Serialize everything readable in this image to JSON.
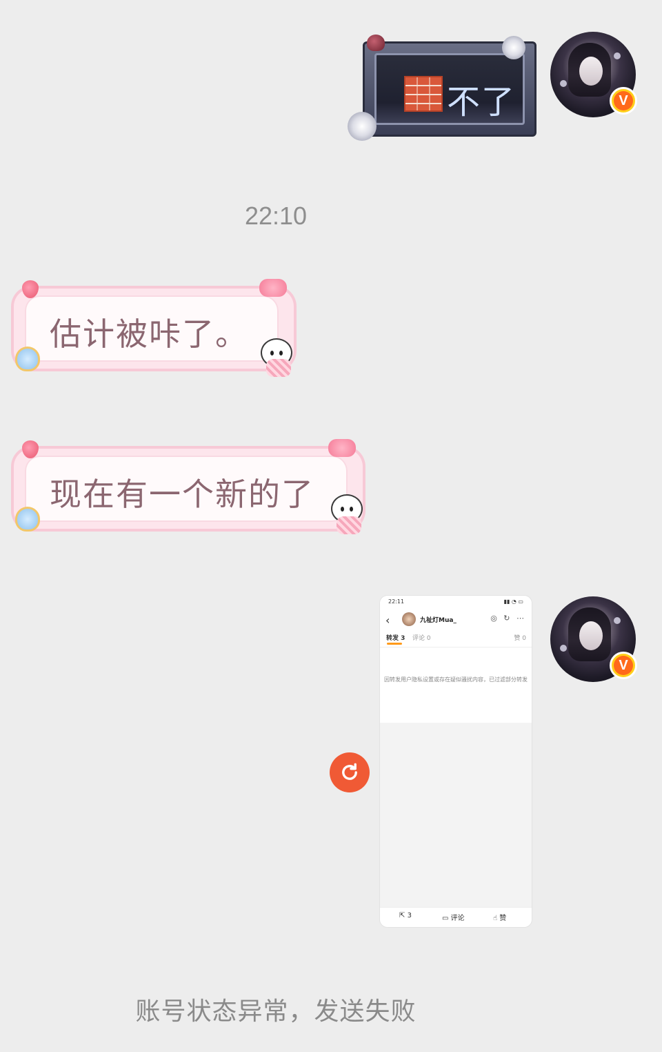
{
  "messages": {
    "sent_sticker_text": "不了",
    "timestamp": "22:10",
    "received_1": "估计被咔了。",
    "received_2": "现在有一个新的了",
    "failure_notice": "账号状态异常，发送失败"
  },
  "sent_avatar": {
    "badge_label": "V",
    "badge_color": "#ffcf1a"
  },
  "screenshot_preview": {
    "status_time": "22:11",
    "username": "九祉灯Mua_",
    "tab_repost": "转发 3",
    "tab_comment": "评论 0",
    "tab_like": "赞 0",
    "notice": "因转发用户隐私设置或存在疑似骚扰内容，已过滤部分转发",
    "repost_count": "3",
    "comment_label": "评论",
    "like_label": "赞"
  },
  "retry_icon": "refresh-icon",
  "colors": {
    "background": "#ededed",
    "retry": "#f05a35",
    "pink_text": "#8b6670"
  }
}
